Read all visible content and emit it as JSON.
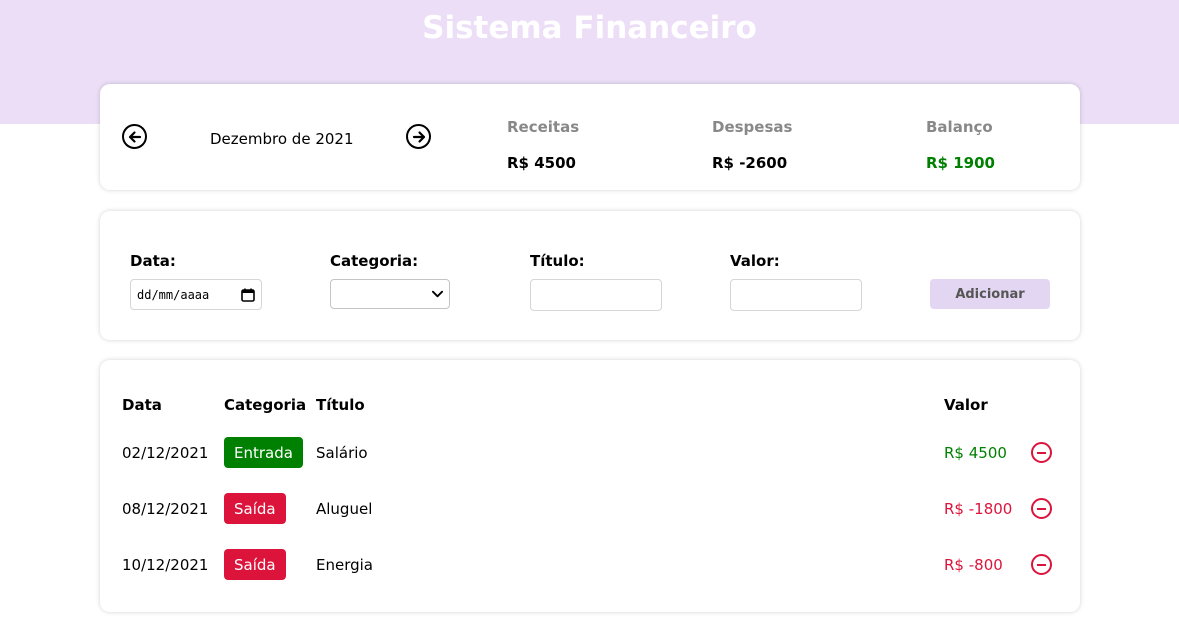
{
  "app": {
    "title": "Sistema Financeiro"
  },
  "summary": {
    "month": "Dezembro de 2021",
    "receitas": {
      "title": "Receitas",
      "value": "R$ 4500"
    },
    "despesas": {
      "title": "Despesas",
      "value": "R$ -2600"
    },
    "balanco": {
      "title": "Balanço",
      "value": "R$ 1900",
      "color": "#008000"
    }
  },
  "form": {
    "data_label": "Data:",
    "data_placeholder": "dd/mm/aaaa",
    "categoria_label": "Categoria:",
    "categoria_value": "",
    "titulo_label": "Título:",
    "titulo_value": "",
    "valor_label": "Valor:",
    "valor_value": "",
    "add_label": "Adicionar"
  },
  "table": {
    "headers": {
      "data": "Data",
      "categoria": "Categoria",
      "titulo": "Título",
      "valor": "Valor"
    },
    "rows": [
      {
        "data": "02/12/2021",
        "categoria": "Entrada",
        "titulo": "Salário",
        "valor": "R$ 4500",
        "cat_color": "#008000",
        "val_color": "#008000"
      },
      {
        "data": "08/12/2021",
        "categoria": "Saída",
        "titulo": "Aluguel",
        "valor": "R$ -1800",
        "cat_color": "#dc143c",
        "val_color": "#dc143c"
      },
      {
        "data": "10/12/2021",
        "categoria": "Saída",
        "titulo": "Energia",
        "valor": "R$ -800",
        "cat_color": "#dc143c",
        "val_color": "#dc143c"
      }
    ]
  },
  "colors": {
    "header_bg": "#ebdef6",
    "button_bg": "#e3d6f2",
    "income": "#008000",
    "expense": "#dc143c"
  }
}
